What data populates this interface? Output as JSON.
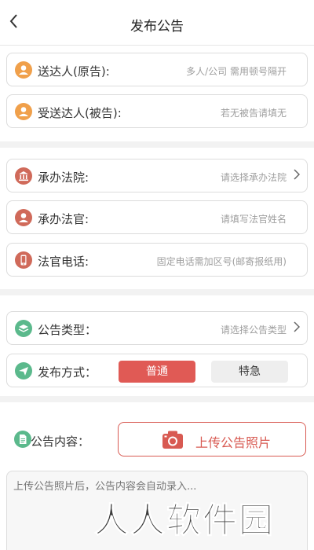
{
  "header": {
    "title": "发布公告",
    "back_icon": "chevron-left-icon"
  },
  "parties": {
    "sender": {
      "label": "送达人(原告):",
      "placeholder": "多人/公司 需用顿号隔开",
      "icon": "person-icon"
    },
    "receiver": {
      "label": "受送达人(被告):",
      "placeholder": "若无被告请填无",
      "icon": "person-icon"
    }
  },
  "court": {
    "court": {
      "label": "承办法院:",
      "placeholder": "请选择承办法院",
      "icon": "courthouse-icon"
    },
    "judge": {
      "label": "承办法官:",
      "placeholder": "请填写法官姓名",
      "icon": "person-icon"
    },
    "phone": {
      "label": "法官电话:",
      "placeholder": "固定电话需加区号(邮寄报纸用)",
      "icon": "phone-icon"
    }
  },
  "notice": {
    "type": {
      "label": "公告类型：",
      "placeholder": "请选择公告类型",
      "icon": "layers-icon"
    },
    "method": {
      "label": "发布方式：",
      "icon": "send-icon",
      "normal": "普通",
      "special": "特急",
      "selected": "普通"
    }
  },
  "content": {
    "label": "公告内容：",
    "upload_label": "上传公告照片",
    "textarea_placeholder": "上传公告照片后，公告内容会自动录入...",
    "icon": "document-icon"
  },
  "watermark": "人人软件园",
  "colors": {
    "accent_red": "#e05a55",
    "orange": "#f0a04b",
    "brick": "#d06a5a",
    "green": "#5bb98c"
  }
}
